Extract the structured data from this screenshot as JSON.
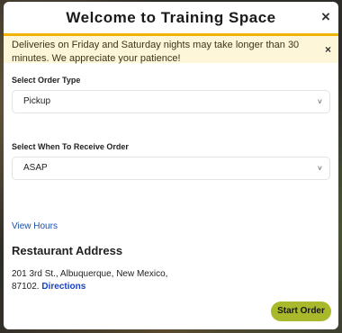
{
  "modal": {
    "title": "Welcome to Training Space",
    "close_icon": "×"
  },
  "notice": {
    "text": "Deliveries on Friday and Saturday nights may take longer than 30 minutes. We appreciate your patience!",
    "close_icon": "×"
  },
  "order_type": {
    "label": "Select Order Type",
    "selected": "Pickup",
    "chevron": "˅"
  },
  "receive_time": {
    "label": "Select When To Receive Order",
    "selected": "ASAP",
    "chevron": "˅"
  },
  "links": {
    "view_hours": "View Hours"
  },
  "address": {
    "title": "Restaurant Address",
    "line1": "201 3rd St., Albuquerque, New Mexico,",
    "line2": "87102.",
    "directions": "Directions"
  },
  "actions": {
    "start_order": "Start Order"
  },
  "colors": {
    "accent": "#f0b400",
    "notice_bg": "#fdf6d8",
    "link": "#1a4fa8",
    "button": "#a9b92b"
  }
}
